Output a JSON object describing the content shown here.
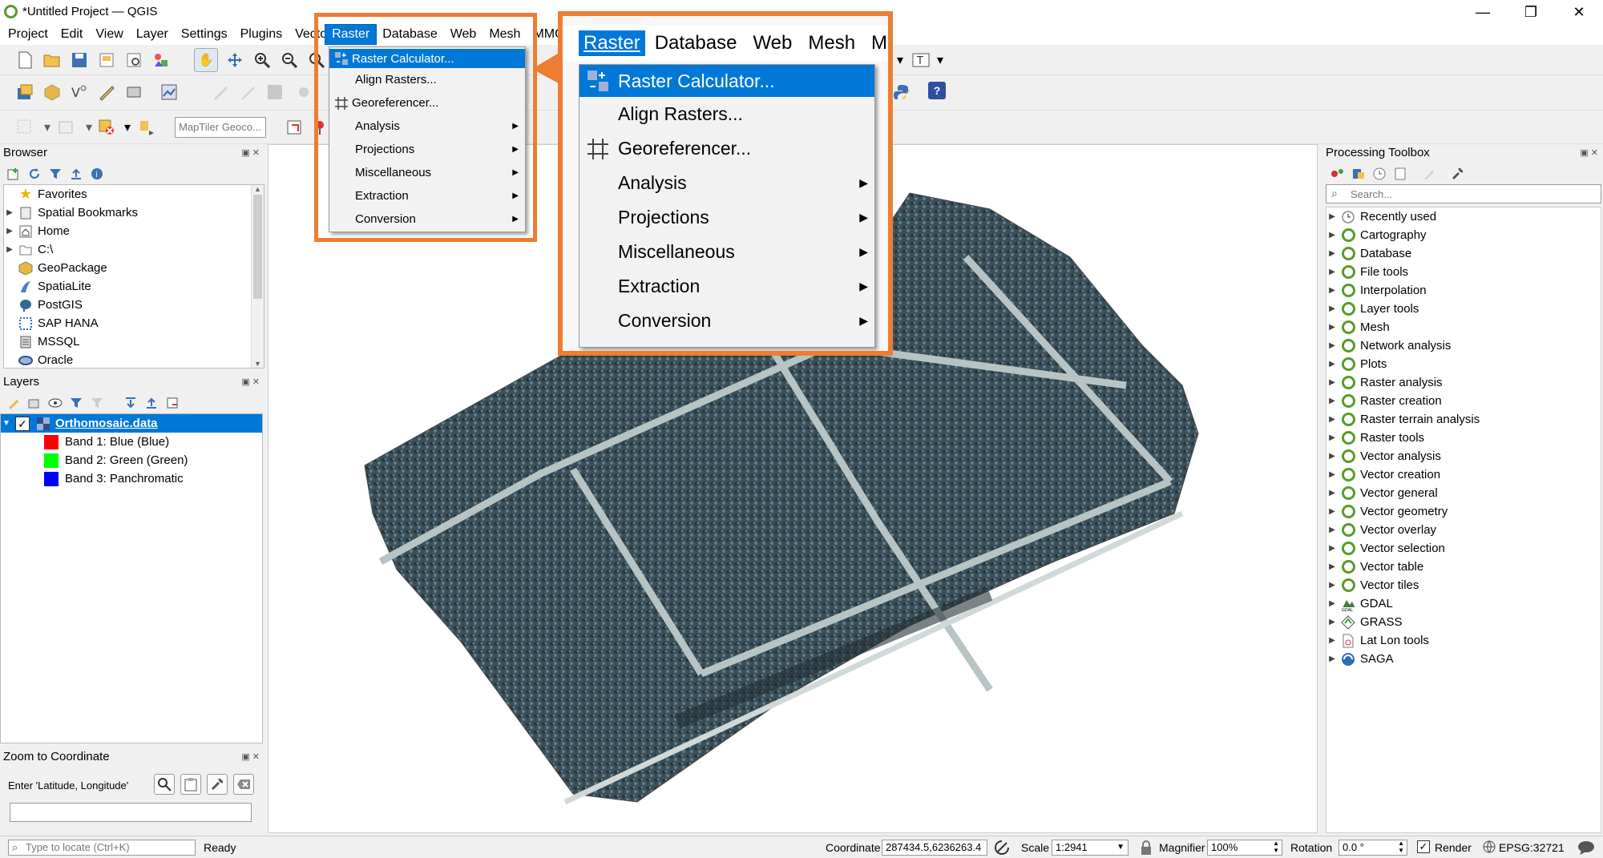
{
  "window": {
    "title": "*Untitled Project — QGIS",
    "minimize": "—",
    "restore": "❐",
    "close": "✕"
  },
  "menubar": [
    "Project",
    "Edit",
    "View",
    "Layer",
    "Settings",
    "Plugins",
    "Vector",
    "Raster",
    "Database",
    "Web",
    "Mesh",
    "MMQGIS"
  ],
  "raster_menu": {
    "items": [
      {
        "label": "Raster Calculator...",
        "icon": "raster-calculator-icon",
        "submenu": false
      },
      {
        "label": "Align Rasters...",
        "icon": "",
        "submenu": false
      },
      {
        "label": "Georeferencer...",
        "icon": "georeferencer-icon",
        "submenu": false
      },
      {
        "label": "Analysis",
        "icon": "",
        "submenu": true
      },
      {
        "label": "Projections",
        "icon": "",
        "submenu": true
      },
      {
        "label": "Miscellaneous",
        "icon": "",
        "submenu": true
      },
      {
        "label": "Extraction",
        "icon": "",
        "submenu": true
      },
      {
        "label": "Conversion",
        "icon": "",
        "submenu": true
      }
    ]
  },
  "zoom_menubar": [
    "Raster",
    "Database",
    "Web",
    "Mesh",
    "M"
  ],
  "locator_placeholder": "MapTiler Geoco...",
  "browser": {
    "title": "Browser",
    "items": [
      "Favorites",
      "Spatial Bookmarks",
      "Home",
      "C:\\",
      "GeoPackage",
      "SpatiaLite",
      "PostGIS",
      "SAP HANA",
      "MSSQL",
      "Oracle"
    ]
  },
  "layers": {
    "title": "Layers",
    "layer": "Orthomosaic.data",
    "bands": [
      {
        "label": "Band 1: Blue (Blue)",
        "color": "#ff0000"
      },
      {
        "label": "Band 2: Green (Green)",
        "color": "#00ff00"
      },
      {
        "label": "Band 3: Panchromatic",
        "color": "#0000ff"
      }
    ]
  },
  "zoom_coord": {
    "title": "Zoom to Coordinate",
    "label": "Enter 'Latitude, Longitude'"
  },
  "toolbox": {
    "title": "Processing Toolbox",
    "search_placeholder": "Search...",
    "items": [
      "Recently used",
      "Cartography",
      "Database",
      "File tools",
      "Interpolation",
      "Layer tools",
      "Mesh",
      "Network analysis",
      "Plots",
      "Raster analysis",
      "Raster creation",
      "Raster terrain analysis",
      "Raster tools",
      "Vector analysis",
      "Vector creation",
      "Vector general",
      "Vector geometry",
      "Vector overlay",
      "Vector selection",
      "Vector table",
      "Vector tiles",
      "GDAL",
      "GRASS",
      "Lat Lon tools",
      "SAGA"
    ]
  },
  "status": {
    "locate_placeholder": "Type to locate (Ctrl+K)",
    "ready": "Ready",
    "coordinate_label": "Coordinate",
    "coordinate": "287434.5,6236263.4",
    "scale_label": "Scale",
    "scale": "1:2941",
    "magnifier_label": "Magnifier",
    "magnifier": "100%",
    "rotation_label": "Rotation",
    "rotation": "0.0 °",
    "render_label": "Render",
    "crs": "EPSG:32721"
  },
  "colors": {
    "highlight": "#0078d7",
    "callout": "#ed7d31"
  }
}
